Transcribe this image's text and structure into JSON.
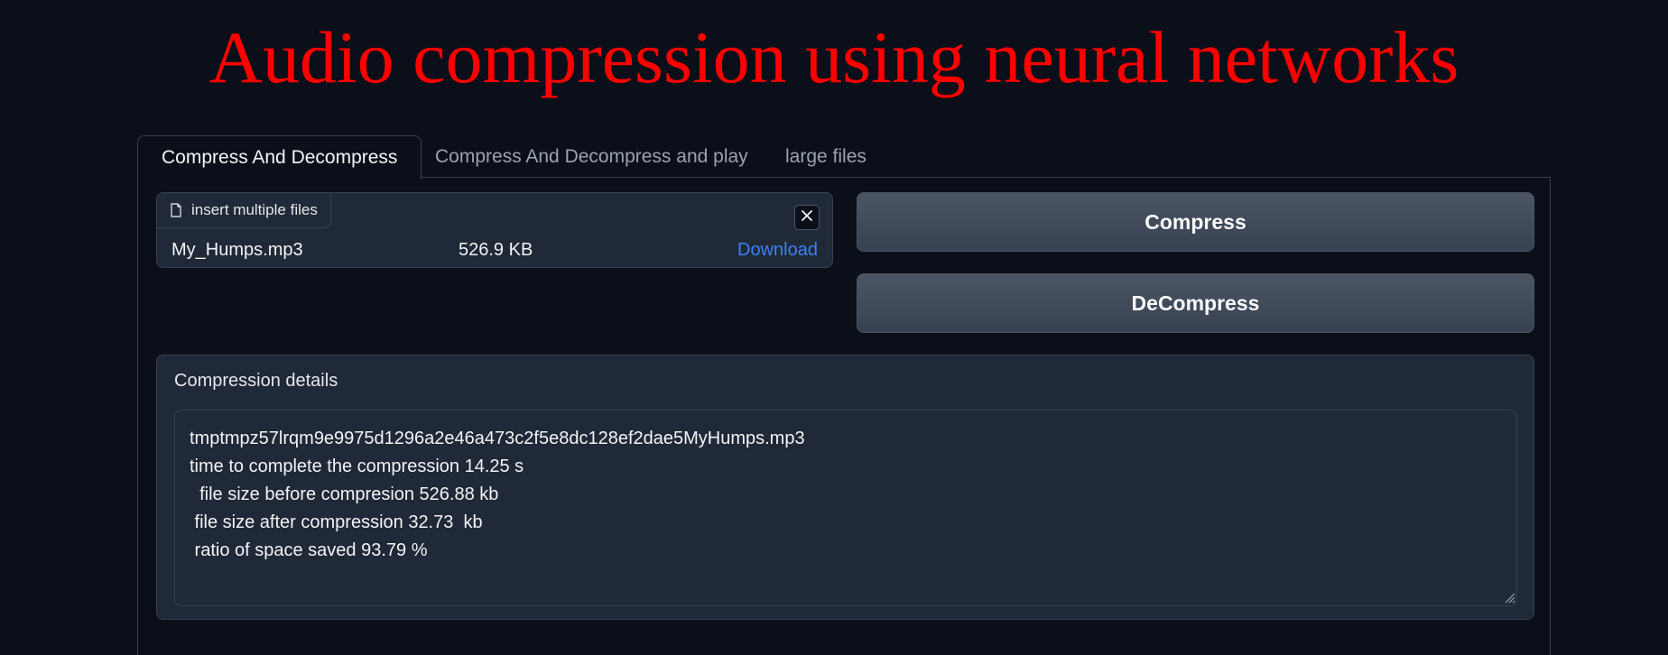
{
  "page": {
    "title": "Audio compression using neural networks"
  },
  "tabs": [
    {
      "label": "Compress And Decompress",
      "active": true
    },
    {
      "label": "Compress And Decompress and play",
      "active": false
    },
    {
      "label": "large files",
      "active": false
    }
  ],
  "file_upload": {
    "label": "insert multiple files",
    "label_icon": "file-icon",
    "clear_icon": "close-icon",
    "file": {
      "name": "My_Humps.mp3",
      "size": "526.9 KB",
      "download_label": "Download"
    }
  },
  "buttons": {
    "compress": "Compress",
    "decompress": "DeCompress"
  },
  "details": {
    "label": "Compression details",
    "text": "tmptmpz57lrqm9e9975d1296a2e46a473c2f5e8dc128ef2dae5MyHumps.mp3\ntime to complete the compression 14.25 s\n  file size before compresion 526.88 kb\n file size after compression 32.73  kb\n ratio of space saved 93.79 %"
  },
  "colors": {
    "background": "#0b0f19",
    "title": "#ff0000",
    "link": "#3b82f6",
    "panel": "#1f2937",
    "border": "#374151"
  }
}
